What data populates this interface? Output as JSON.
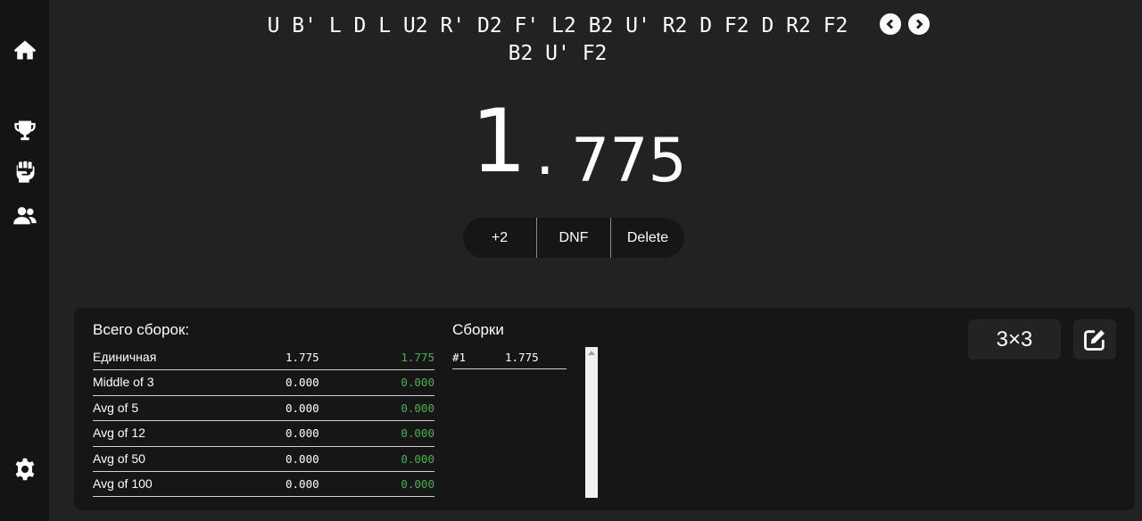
{
  "sidebar": {
    "items": [
      {
        "icon": "home-icon"
      },
      {
        "icon": "trophy-icon"
      },
      {
        "icon": "fist-icon"
      },
      {
        "icon": "users-icon"
      },
      {
        "icon": "gear-icon"
      }
    ]
  },
  "scramble": {
    "line1": "U B' L D L U2 R' D2 F' L2 B2 U' R2 D F2 D R2 F2",
    "line2": "B2 U' F2"
  },
  "timer": {
    "integer": "1",
    "dot": ".",
    "decimals": "775"
  },
  "penalty": {
    "plus2": "+2",
    "dnf": "DNF",
    "delete": "Delete"
  },
  "stats": {
    "title": "Всего сборок:",
    "rows": [
      {
        "label": "Единичная",
        "current": "1.775",
        "best": "1.775"
      },
      {
        "label": "Middle of 3",
        "current": "0.000",
        "best": "0.000"
      },
      {
        "label": "Avg of 5",
        "current": "0.000",
        "best": "0.000"
      },
      {
        "label": "Avg of 12",
        "current": "0.000",
        "best": "0.000"
      },
      {
        "label": "Avg of 50",
        "current": "0.000",
        "best": "0.000"
      },
      {
        "label": "Avg of 100",
        "current": "0.000",
        "best": "0.000"
      }
    ]
  },
  "solves": {
    "title": "Сборки",
    "items": [
      {
        "num": "#1",
        "time": "1.775"
      }
    ]
  },
  "puzzle": {
    "label": "3×3"
  },
  "colors": {
    "background": "#222222",
    "sidebar": "#141414",
    "panel": "#161616",
    "best": "#4caf50"
  }
}
